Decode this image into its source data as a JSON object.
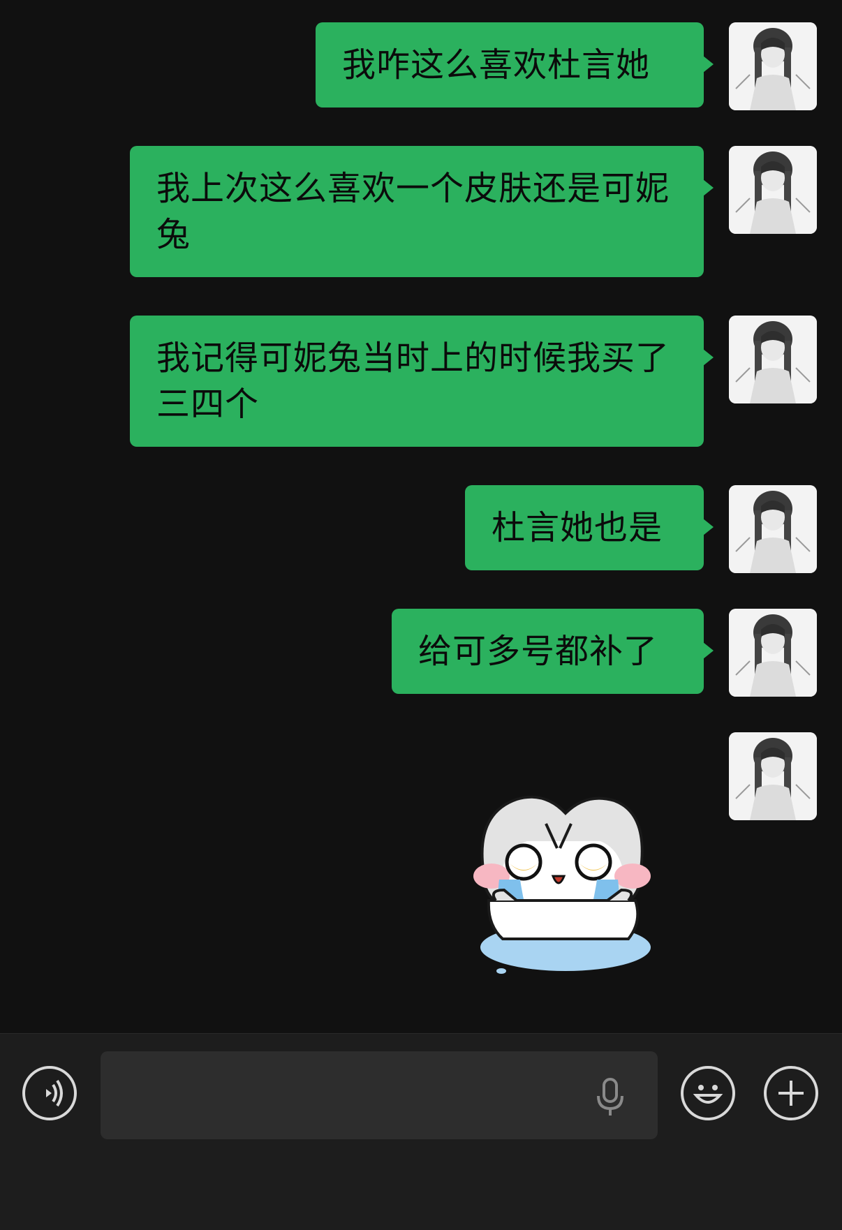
{
  "messages": [
    {
      "text": "我咋这么喜欢杜言她"
    },
    {
      "text": "我上次这么喜欢一个皮肤还是可妮兔"
    },
    {
      "text": "我记得可妮兔当时上的时候我买了三四个"
    },
    {
      "text": "杜言她也是"
    },
    {
      "text": "给可多号都补了"
    }
  ],
  "input": {
    "value": "",
    "placeholder": ""
  },
  "icons": {
    "voice": "voice-mode-icon",
    "mic": "microphone-icon",
    "emoji": "emoji-icon",
    "more": "plus-icon"
  },
  "colors": {
    "background": "#111111",
    "bubble": "#2bb15e",
    "input_bar": "#1d1d1d"
  }
}
